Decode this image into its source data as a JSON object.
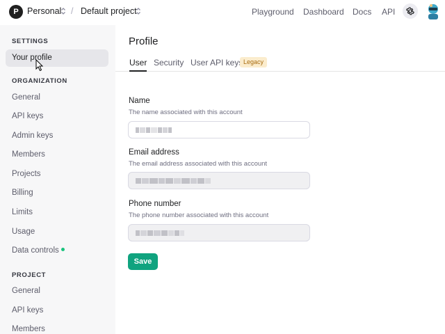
{
  "topbar": {
    "org_initial": "P",
    "org_name": "Personal",
    "separator": "/",
    "project_name": "Default project",
    "links": [
      "Playground",
      "Dashboard",
      "Docs",
      "API"
    ]
  },
  "sidebar": {
    "settings_header": "SETTINGS",
    "settings_items": [
      "Your profile"
    ],
    "organization_header": "ORGANIZATION",
    "organization_items": [
      "General",
      "API keys",
      "Admin keys",
      "Members",
      "Projects",
      "Billing",
      "Limits",
      "Usage",
      "Data controls"
    ],
    "project_header": "PROJECT",
    "project_items": [
      "General",
      "API keys",
      "Members"
    ]
  },
  "main": {
    "title": "Profile",
    "tabs": [
      "User",
      "Security",
      "User API keys"
    ],
    "legacy_badge": "Legacy",
    "fields": [
      {
        "label": "Name",
        "help": "The name associated with this account"
      },
      {
        "label": "Email address",
        "help": "The email address associated with this account"
      },
      {
        "label": "Phone number",
        "help": "The phone number associated with this account"
      }
    ],
    "save_label": "Save"
  },
  "colors": {
    "accent": "#10a37f",
    "status_dot": "#19c37d",
    "badge_bg": "#fbeccd",
    "badge_text": "#a86c10"
  }
}
